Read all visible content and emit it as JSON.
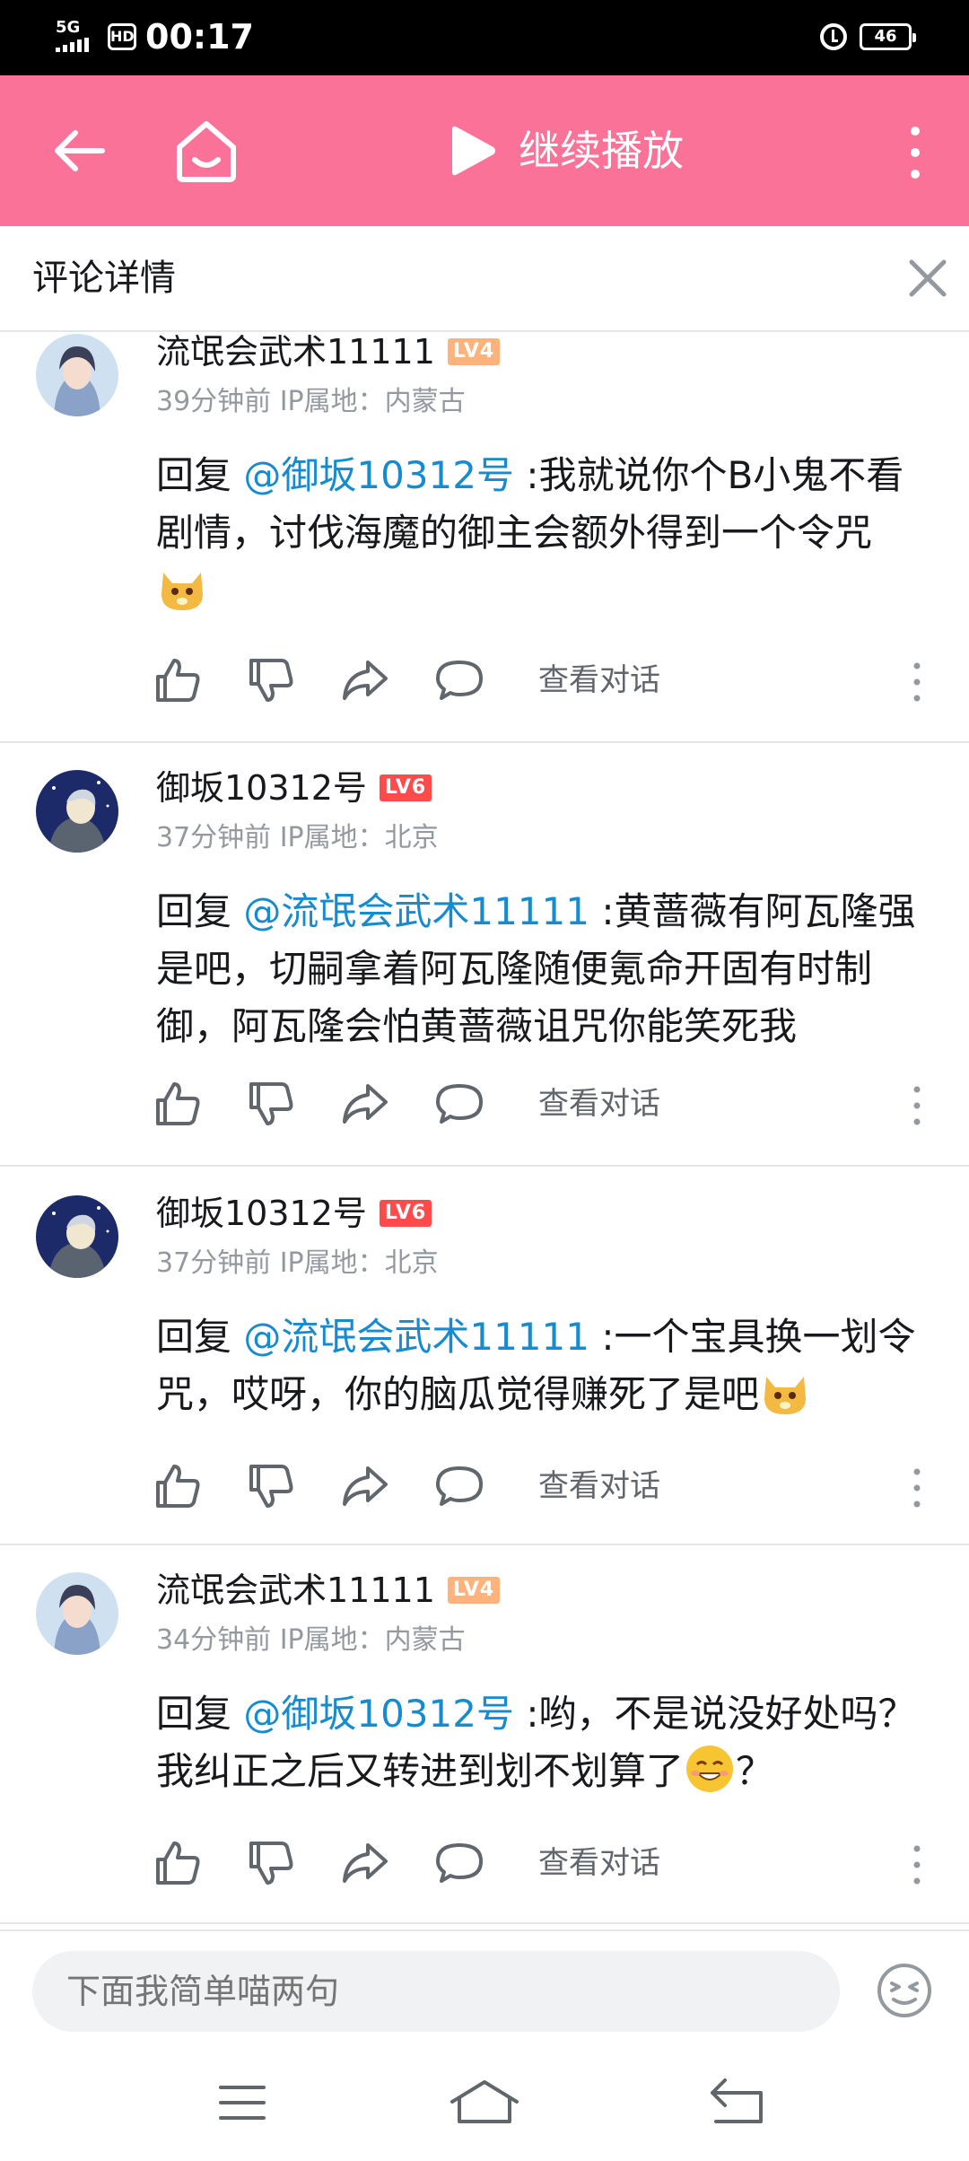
{
  "status_bar": {
    "network": "5G",
    "hd": "HD",
    "time": "00:17",
    "battery": "46"
  },
  "topbar": {
    "continue_label": "继续播放"
  },
  "detail": {
    "title": "评论详情"
  },
  "comments": [
    {
      "username": "流氓会武术11111",
      "level": "LV4",
      "meta": "39分钟前 IP属地：内蒙古",
      "reply_prefix": "回复 ",
      "mention": "@御坂10312号",
      "text": " :我就说你个B小鬼不看剧情，讨伐海魔的御主会额外得到一个令咒",
      "trailing": "",
      "view_label": "查看对话"
    },
    {
      "username": "御坂10312号",
      "level": "LV6",
      "meta": "37分钟前 IP属地：北京",
      "reply_prefix": "回复 ",
      "mention": "@流氓会武术11111",
      "text": " :黄蔷薇有阿瓦隆强是吧，切嗣拿着阿瓦隆随便氪命开固有时制御，阿瓦隆会怕黄蔷薇诅咒你能笑死我",
      "trailing": "",
      "view_label": "查看对话"
    },
    {
      "username": "御坂10312号",
      "level": "LV6",
      "meta": "37分钟前 IP属地：北京",
      "reply_prefix": "回复 ",
      "mention": "@流氓会武术11111",
      "text": " :一个宝具换一划令咒，哎呀，你的脑瓜觉得赚死了是吧",
      "trailing": "",
      "view_label": "查看对话"
    },
    {
      "username": "流氓会武术11111",
      "level": "LV4",
      "meta": "34分钟前 IP属地：内蒙古",
      "reply_prefix": "回复 ",
      "mention": "@御坂10312号",
      "text": " :哟，不是说没好处吗？我纠正之后又转进到划不划算了",
      "trailing": "？",
      "view_label": "查看对话"
    }
  ],
  "input": {
    "placeholder": "下面我简单喵两句"
  },
  "colors": {
    "brand_pink": "#fb7299",
    "mention_blue": "#178bcf",
    "meta_gray": "#9499a0"
  }
}
